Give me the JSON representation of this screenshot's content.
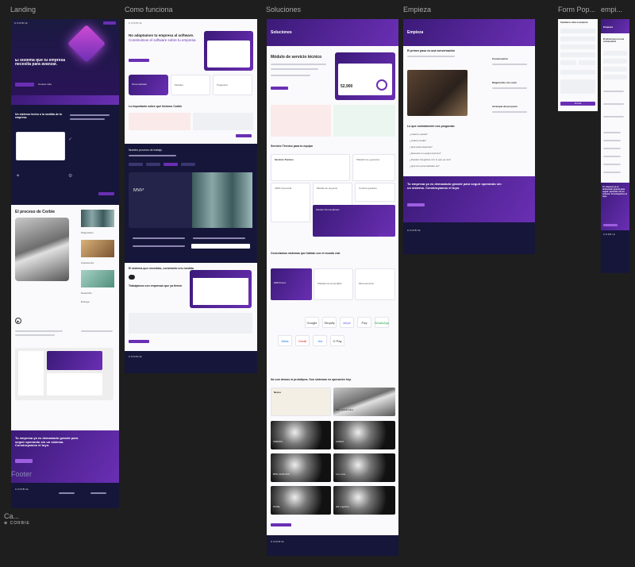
{
  "canvas": {
    "frames": [
      {
        "id": "landing",
        "label": "Landing"
      },
      {
        "id": "como",
        "label": "Como funciona"
      },
      {
        "id": "soluciones",
        "label": "Soluciones"
      },
      {
        "id": "empieza",
        "label": "Empieza"
      },
      {
        "id": "form",
        "label": "Form Pop..."
      },
      {
        "id": "empi",
        "label": "empi..."
      },
      {
        "id": "ca",
        "label": "Ca..."
      }
    ],
    "brand": "CORBIE",
    "footer_label": "Footer"
  },
  "landing": {
    "hero_title": "El sistema que tu empresa necesita para avanzar.",
    "hero_cta": "Agenda tu demo",
    "hero_link": "Conoce más",
    "dark_title": "Un sistema hecho a la medida de tu empresa",
    "process_title": "El proceso de Corbie",
    "steps": [
      "Diagnóstico",
      "Arquitectura",
      "Desarrollo",
      "Entrega"
    ],
    "cta_title": "Tu empresa ya es demasiado grande para seguir operando sin un sistema. Construyamos el tuyo.",
    "cta_button": "Agenda tu demo"
  },
  "como": {
    "intro": "No adaptamos tu empresa al software.",
    "intro_accent": "Construimos el software sobre tu empresa",
    "cards": [
      "Personalizado",
      "Modular",
      "Progresivo"
    ],
    "sub_title": "Lo importante sobre qué hicimos Corbie",
    "modular_title": "Nuestro proceso de trabajo",
    "mvp": "MVP",
    "closing": "El sistema que necesitas, construido a tu medida",
    "hero_label": "Trabajamos con empresas que ya tienen"
  },
  "soluciones": {
    "header": "Soluciones",
    "module_title": "Módulo de servicio técnico",
    "amount": "52,900",
    "services_title": "Servicio Técnico para tu equipo",
    "grid": [
      "Servicio Técnico",
      "Plataforma y gerentes",
      "CRM Comercial",
      "Módulo de proyecto",
      "Control operativo",
      "Módulo Personalizado"
    ],
    "platform_title": "Conectamos sistemas que hablan con el mundo real",
    "platform_cards": [
      "ERP/Cloud",
      "Plataforma Conectable",
      "Microservicios"
    ],
    "integrations": [
      "Google",
      "Shopify",
      "stripe",
      "Pay",
      "WhatsApp",
      "Meta",
      "Gmail",
      "Jira",
      "G Pay"
    ],
    "cases_title": "No son demos ni prototipos. Son sistemas en operación hoy.",
    "cases": [
      "Nexus",
      "DEC Desarrollos",
      "SIMMOC",
      "AUREA",
      "BMC ANALISIS",
      "Lux Lane",
      "DOSE",
      "HR Logistics"
    ]
  },
  "empieza": {
    "header": "Empieza",
    "first_step": "El primer paso es una conversación",
    "steps": [
      "Conversación",
      "Diagnóstico sin costo",
      "Arranque del proyecto"
    ],
    "faq_title": "Lo que normalmente nos preguntan",
    "faqs": [
      "¿Cuánto cuesta?",
      "¿Cuánto tarda?",
      "¿Qué pasa después?",
      "¿Necesito un equipo técnico?",
      "¿Pueden integrarse con lo que ya uso?",
      "¿Qué tan personalizado es?"
    ],
    "cta_title": "Tu empresa ya es demasiado grande para seguir operando sin un sistema. Construyamos el tuyo.",
    "cta_button": "Agenda tu demo"
  },
  "form": {
    "title": "Cuéntanos sobre tu empresa",
    "submit": "Enviar"
  },
  "empi_small": {
    "header": "Empieza",
    "title": "El primer paso es una conversación",
    "cta": "Tu empresa ya es demasiado grande para seguir operando sin un sistema. Construyamos el tuyo."
  }
}
